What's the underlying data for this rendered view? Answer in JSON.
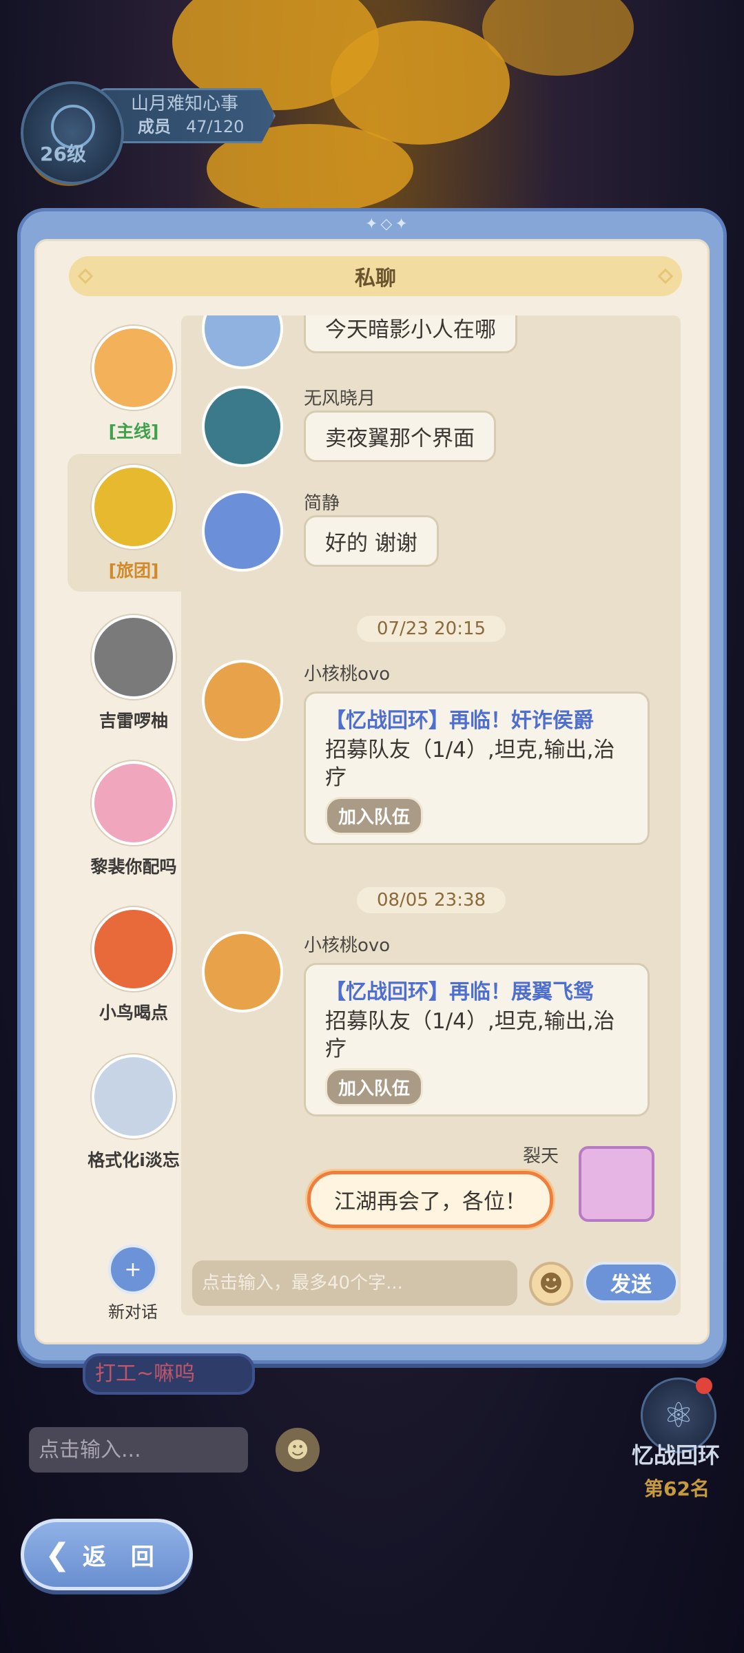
{
  "guild": {
    "name": "山月难知心事",
    "members_label": "成员",
    "members_count": "47/120",
    "level": "26级"
  },
  "modal": {
    "title": "私聊"
  },
  "sidebar": {
    "contacts": [
      {
        "name": "[主线]",
        "color": "#3fa24a",
        "avatar_color": "#f3b25a"
      },
      {
        "name": "[旅团]",
        "color": "#d18a2a",
        "avatar_color": "#e7b92e"
      },
      {
        "name": "吉雷啰柚",
        "color": "#3c3a38",
        "avatar_color": "#7a7a7a"
      },
      {
        "name": "黎裴你配吗",
        "color": "#3c3a38",
        "avatar_color": "#f0a6bd"
      },
      {
        "name": "小鸟喝点",
        "color": "#3c3a38",
        "avatar_color": "#e86a3a"
      },
      {
        "name": "格式化i淡忘",
        "color": "#3c3a38",
        "avatar_color": "#c7d4e6"
      }
    ],
    "new_chat_label": "新对话"
  },
  "chat": {
    "messages": [
      {
        "sender": "",
        "text": "今天暗影小人在哪"
      },
      {
        "sender": "无风晓月",
        "text": "卖夜翼那个界面"
      },
      {
        "sender": "简静",
        "text": "好的 谢谢"
      }
    ],
    "timestamps": [
      "07/23 20:15",
      "08/05 23:38"
    ],
    "cards": [
      {
        "sender": "小核桃ovo",
        "title": "【忆战回环】再临！奸诈侯爵",
        "body": "招募队友（1/4）,坦克,输出,治疗",
        "button": "加入队伍"
      },
      {
        "sender": "小核桃ovo",
        "title": "【忆战回环】再临！展翼飞鸳",
        "body": "招募队友（1/4）,坦克,输出,治疗",
        "button": "加入队伍"
      }
    ],
    "mine": {
      "sender": "裂天",
      "text": "江湖再会了，各位！"
    },
    "input_placeholder": "点击输入，最多40个字...",
    "send_label": "发送"
  },
  "background": {
    "bubble_text": "打工~嘛呜",
    "input_placeholder": "点击输入...",
    "event_title": "忆战回环",
    "event_rank": "第62名",
    "back_label": "返 回"
  }
}
